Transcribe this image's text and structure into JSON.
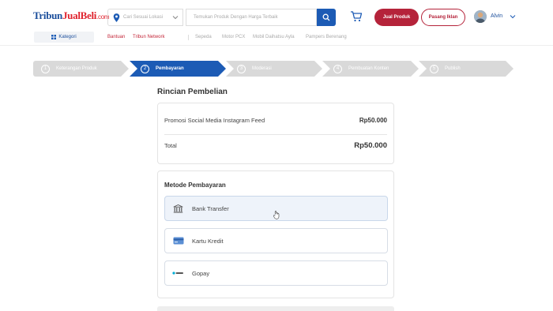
{
  "header": {
    "logo": {
      "part1": "Tribun",
      "part2": "JualBeli",
      "part3": ".com"
    },
    "location_placeholder": "Cari Sesuai Lokasi",
    "search_placeholder": "Temukan Produk Dengan Harga Terbaik",
    "jual_label": "Jual Produk",
    "pasang_label": "Pasang Iklan",
    "username": "Alvin"
  },
  "subnav": {
    "kategori": "Kategori",
    "links_red": [
      "Bantuan",
      "Tribun Network"
    ],
    "links_grey": [
      "Sepeda",
      "Motor PCX",
      "Mobil Daihatsu Ayla",
      "Pampers Berenang"
    ]
  },
  "steps": [
    {
      "num": "1",
      "label": "Keterangan Produk",
      "active": false
    },
    {
      "num": "2",
      "label": "Pembayaran",
      "active": true
    },
    {
      "num": "3",
      "label": "Moderasi",
      "active": false
    },
    {
      "num": "4",
      "label": "Pembuatan Konten",
      "active": false
    },
    {
      "num": "5",
      "label": "Publish",
      "active": false
    }
  ],
  "rincian": {
    "title": "Rincian Pembelian",
    "item_name": "Promosi Social Media Instagram Feed",
    "item_price": "Rp50.000",
    "total_label": "Total",
    "total_price": "Rp50.000"
  },
  "metode": {
    "title": "Metode Pembayaran",
    "options": [
      {
        "label": "Bank Transfer",
        "icon": "bank-icon",
        "selected": true
      },
      {
        "label": "Kartu Kredit",
        "icon": "credit-card-icon",
        "selected": false
      },
      {
        "label": "Gopay",
        "icon": "gopay-icon",
        "selected": false
      }
    ]
  },
  "colors": {
    "primary": "#1c5bb5",
    "accent": "#b5233a",
    "step_inactive": "#d9d9d9"
  }
}
